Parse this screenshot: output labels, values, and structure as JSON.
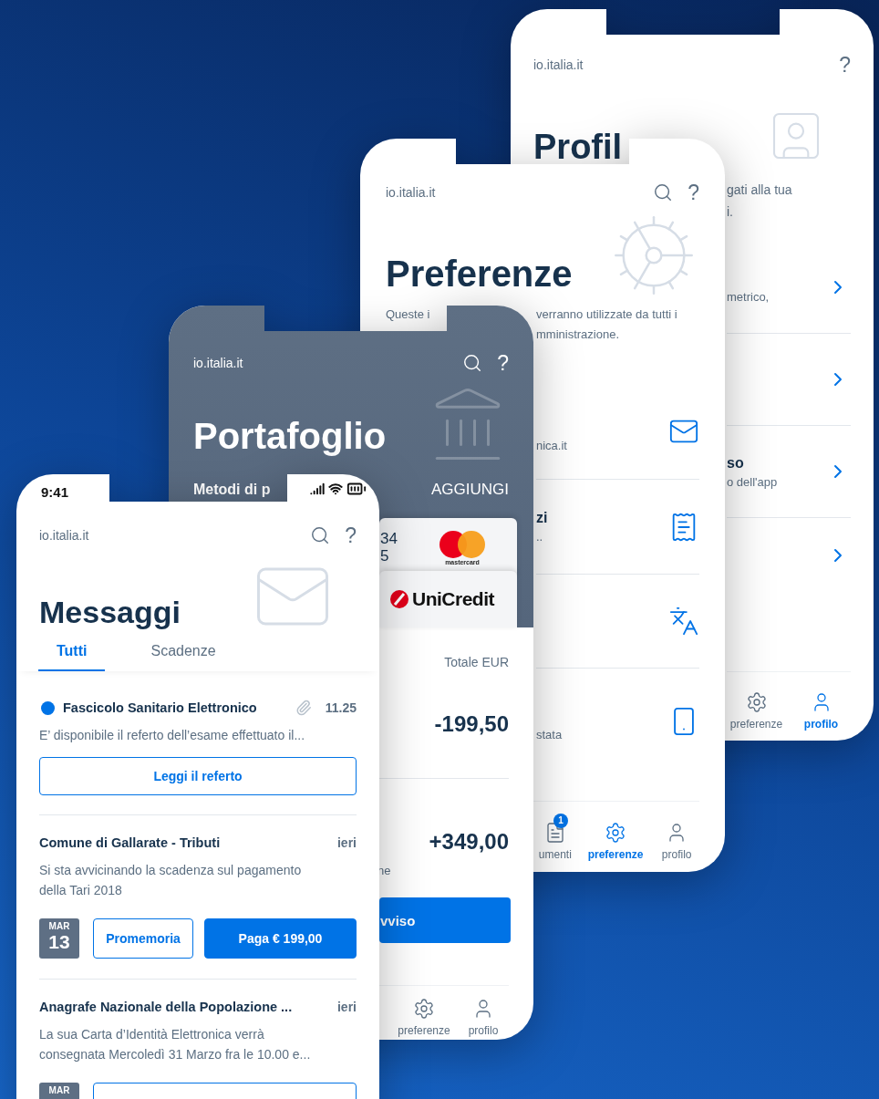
{
  "profilo_screen": {
    "site": "io.italia.it",
    "help": "?",
    "title": "Profil",
    "description_fragments": [
      "gati alla tua",
      "i."
    ],
    "rows": [
      {
        "kind": "link",
        "subtitle": "metrico,"
      },
      {
        "kind": "link"
      },
      {
        "kind": "link",
        "title": "so",
        "subtitle": "o dell'app"
      },
      {
        "kind": "link"
      }
    ],
    "tab_bar": [
      {
        "kind": "preferences",
        "label": "preferenze",
        "selected": false
      },
      {
        "kind": "profile",
        "label": "profilo",
        "selected": true
      }
    ]
  },
  "preferenze_screen": {
    "site": "io.italia.it",
    "help": "?",
    "title": "Preferenze",
    "description_fragments": [
      "Queste i",
      "verranno utilizzate da tutti i",
      "mministrazione."
    ],
    "rows": [
      {
        "kind": "mail",
        "subtitle": "nica.it"
      },
      {
        "kind": "receipt",
        "title": "zi",
        "subtitle": ".."
      },
      {
        "kind": "translate"
      },
      {
        "kind": "phone",
        "subtitle": "stata"
      }
    ],
    "tab_bar": [
      {
        "kind": "documents",
        "label": "umenti",
        "badge": "1",
        "selected": false
      },
      {
        "kind": "preferences",
        "label": "preferenze",
        "selected": true
      },
      {
        "kind": "profile",
        "label": "profilo",
        "selected": false
      }
    ]
  },
  "portafoglio_screen": {
    "site": "io.italia.it",
    "help": "?",
    "title": "Portafoglio",
    "section": "Metodi di p",
    "add": "AGGIUNGI",
    "cards": [
      {
        "kind": "mastercard",
        "number_fragments": [
          "34",
          "5"
        ],
        "brand": "mastercard"
      },
      {
        "kind": "unicredit",
        "brand": "UniCredit"
      }
    ],
    "total_label": "Totale EUR",
    "transactions": [
      {
        "amount": "-199,50"
      },
      {
        "amount": "+349,00",
        "note": "ne"
      }
    ],
    "button": "vviso",
    "tab_bar": [
      {
        "kind": "preferences",
        "label": "preferenze",
        "selected": false
      },
      {
        "kind": "profile",
        "label": "profilo",
        "selected": false
      }
    ]
  },
  "messaggi_screen": {
    "time": "9:41",
    "site": "io.italia.it",
    "help": "?",
    "title": "Messaggi",
    "tabs": [
      {
        "label": "Tutti",
        "selected": true
      },
      {
        "label": "Scadenze",
        "selected": false
      }
    ],
    "messages": [
      {
        "unread": true,
        "attachment": true,
        "title": "Fascicolo Sanitario Elettronico",
        "time": "11.25",
        "preview": "E’ disponibile il referto dell’esame effettuato il...",
        "actions": [
          {
            "kind": "outline",
            "label": "Leggi il referto"
          }
        ]
      },
      {
        "unread": false,
        "attachment": false,
        "title": "Comune di Gallarate - Tributi",
        "time": "ieri",
        "preview": "Si sta avvicinando la scadenza sul pagamento della Tari 2018",
        "date": {
          "month": "MAR",
          "day": "13"
        },
        "actions": [
          {
            "kind": "outline",
            "label": "Promemoria"
          },
          {
            "kind": "filled",
            "label": "Paga € 199,00"
          }
        ]
      },
      {
        "unread": false,
        "attachment": false,
        "title": "Anagrafe Nazionale della Popolazione ...",
        "time": "ieri",
        "preview": "La sua Carta d’Identità Elettronica verrà consegnata Mercoledì 31 Marzo fra le 10.00 e...",
        "date": {
          "month": "MAR"
        },
        "actions": [
          {
            "kind": "outline"
          }
        ]
      }
    ]
  }
}
